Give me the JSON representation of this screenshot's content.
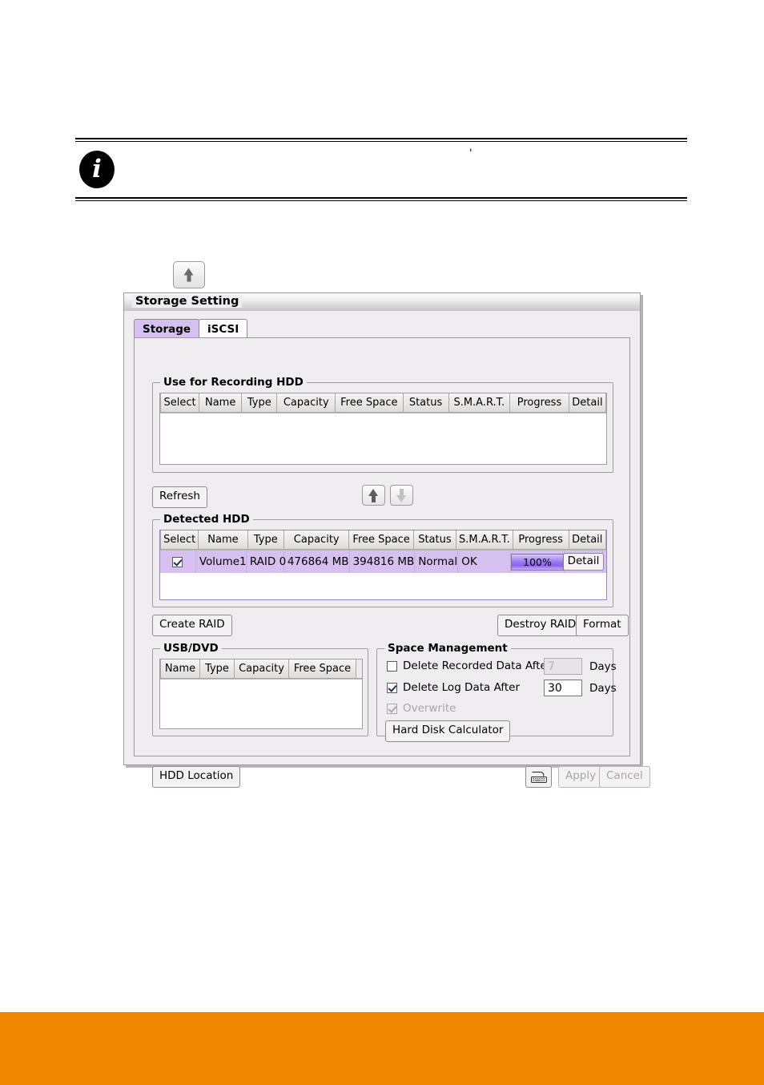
{
  "note": {
    "icon": "info-icon",
    "glyph": "i",
    "tick_mark": "'"
  },
  "standalone_button": {
    "icon": "arrow-up-icon"
  },
  "dialog": {
    "title": "Storage Setting",
    "tabs": [
      {
        "label": "Storage",
        "active": true
      },
      {
        "label": "iSCSI",
        "active": false
      }
    ],
    "recording_hdd": {
      "title": "Use for Recording HDD",
      "columns": [
        "Select",
        "Name",
        "Type",
        "Capacity",
        "Free Space",
        "Status",
        "S.M.A.R.T.",
        "Progress",
        "Detail"
      ],
      "rows": []
    },
    "toolbar": {
      "refresh_label": "Refresh",
      "move_up_icon": "arrow-up-icon",
      "move_down_icon": "arrow-down-icon"
    },
    "detected_hdd": {
      "title": "Detected HDD",
      "columns": [
        "Select",
        "Name",
        "Type",
        "Capacity",
        "Free Space",
        "Status",
        "S.M.A.R.T.",
        "Progress",
        "Detail"
      ],
      "rows": [
        {
          "selected": true,
          "name": "Volume1",
          "type": "RAID 0",
          "capacity": "476864 MB",
          "free_space": "394816 MB",
          "status": "Normal",
          "smart": "OK",
          "progress_text": "100%",
          "progress_percent": 100,
          "detail_label": "Detail"
        }
      ]
    },
    "raid_actions": {
      "create_label": "Create RAID",
      "destroy_label": "Destroy RAID",
      "format_label": "Format"
    },
    "usb_dvd": {
      "title": "USB/DVD",
      "columns": [
        "Name",
        "Type",
        "Capacity",
        "Free Space"
      ],
      "rows": []
    },
    "space_management": {
      "title": "Space Management",
      "delete_recorded": {
        "label": "Delete Recorded Data After",
        "checked": false,
        "value": "7",
        "unit": "Days",
        "enabled": false
      },
      "delete_log": {
        "label": "Delete Log Data After",
        "checked": true,
        "value": "30",
        "unit": "Days",
        "enabled": true
      },
      "overwrite": {
        "label": "Overwrite",
        "checked": true,
        "enabled": false
      },
      "calculator_label": "Hard Disk Calculator"
    },
    "footer": {
      "hdd_location_label": "HDD Location",
      "keyboard_icon": "keyboard-icon",
      "apply_label": "Apply",
      "apply_enabled": false,
      "cancel_label": "Cancel",
      "cancel_enabled": false
    }
  },
  "colors": {
    "accent_purple": "#d6c0f0",
    "progress_purple": "#8a61ec",
    "footer_orange": "#ef8700",
    "dialog_bg": "#f0edf0"
  }
}
